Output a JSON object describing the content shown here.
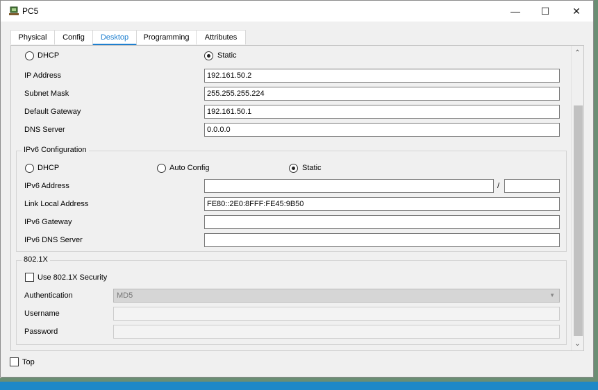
{
  "window": {
    "title": "PC5",
    "minimize_glyph": "—",
    "maximize_glyph": "☐",
    "close_glyph": "✕"
  },
  "tabs": [
    {
      "label": "Physical"
    },
    {
      "label": "Config"
    },
    {
      "label": "Desktop",
      "active": true
    },
    {
      "label": "Programming"
    },
    {
      "label": "Attributes"
    }
  ],
  "ipv4": {
    "dhcp_label": "DHCP",
    "static_label": "Static",
    "mode": "Static",
    "ip_label": "IP Address",
    "ip_value": "192.161.50.2",
    "mask_label": "Subnet Mask",
    "mask_value": "255.255.255.224",
    "gateway_label": "Default Gateway",
    "gateway_value": "192.161.50.1",
    "dns_label": "DNS Server",
    "dns_value": "0.0.0.0"
  },
  "ipv6": {
    "group_title": "IPv6 Configuration",
    "dhcp_label": "DHCP",
    "auto_label": "Auto Config",
    "static_label": "Static",
    "mode": "Static",
    "address_label": "IPv6 Address",
    "address_value": "",
    "slash": "/",
    "prefix_value": "",
    "link_local_label": "Link Local Address",
    "link_local_value": "FE80::2E0:8FFF:FE45:9B50",
    "gateway_label": "IPv6 Gateway",
    "gateway_value": "",
    "dns_label": "IPv6 DNS Server",
    "dns_value": ""
  },
  "dot1x": {
    "group_title": "802.1X",
    "use_label": "Use 802.1X Security",
    "use_checked": false,
    "auth_label": "Authentication",
    "auth_value": "MD5",
    "username_label": "Username",
    "username_value": "",
    "password_label": "Password",
    "password_value": ""
  },
  "footer": {
    "top_label": "Top",
    "top_checked": false
  },
  "colors": {
    "accent": "#1e7fcf",
    "taskbar": "#1e88c7"
  }
}
